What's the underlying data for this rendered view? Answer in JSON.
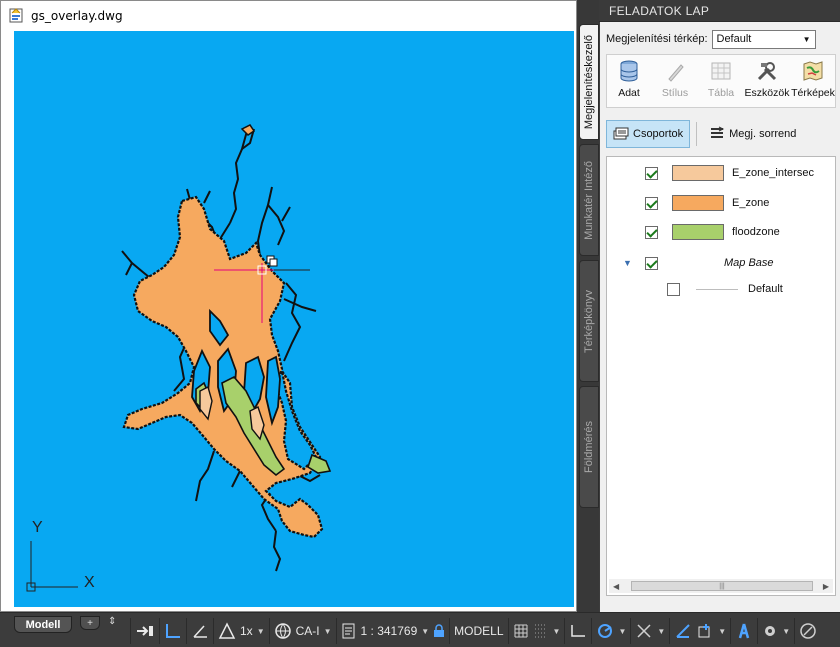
{
  "document": {
    "title": "gs_overlay.dwg",
    "icon": "dwg-file-icon"
  },
  "colors": {
    "canvas_bg": "#08a8f2",
    "e_zone_intersect": "#f6c99c",
    "e_zone": "#f6a95f",
    "floodzone": "#a8d06b",
    "crosshair": "#e4007c"
  },
  "ucs": {
    "x_label": "X",
    "y_label": "Y"
  },
  "palette": {
    "title": "FELADATOK LAP",
    "tabs": [
      {
        "label": "Megjelenítéskezelő",
        "active": true
      },
      {
        "label": "Munkatér Intéző",
        "active": false
      },
      {
        "label": "Térképkönyv",
        "active": false
      },
      {
        "label": "Földmérés",
        "active": false
      }
    ],
    "map_label": "Megjelenítési térkép:",
    "map_value": "Default",
    "tools": [
      {
        "label": "Adat",
        "icon": "data-icon",
        "enabled": true
      },
      {
        "label": "Stílus",
        "icon": "style-icon",
        "enabled": false
      },
      {
        "label": "Tábla",
        "icon": "table-icon",
        "enabled": false
      },
      {
        "label": "Eszközök",
        "icon": "tools-icon",
        "enabled": true
      },
      {
        "label": "Térképek",
        "icon": "maps-icon",
        "enabled": true
      }
    ],
    "view_groups": "Csoportok",
    "view_draw_order": "Megj. sorrend",
    "layers": [
      {
        "name": "E_zone_intersec",
        "checked": true
      },
      {
        "name": "E_zone",
        "checked": true
      },
      {
        "name": "floodzone",
        "checked": true
      }
    ],
    "group": {
      "name": "Map Base",
      "checked": true
    },
    "group_child": {
      "name": "Default",
      "checked": false
    }
  },
  "statusbar": {
    "model_tab": "Modell",
    "add_tab": "+",
    "annotation_scale": "1x",
    "coord_system": "CA-I",
    "scale": "1 : 341769",
    "space": "MODELL"
  }
}
